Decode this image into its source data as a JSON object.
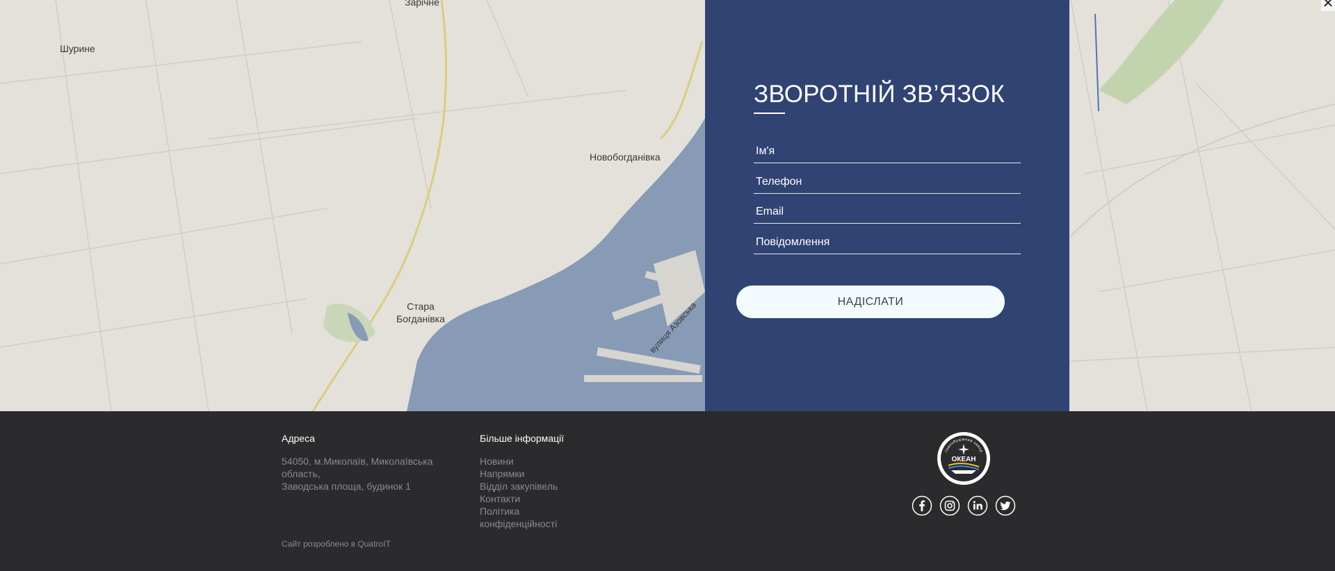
{
  "map": {
    "labels": {
      "zarichne": "Зарічне",
      "shuryne": "Шурине",
      "novobohdanivka": "Новобогданівка",
      "stara_line1": "Стара",
      "stara_line2": "Богданівка",
      "street": "вулиця Азовська"
    },
    "close_glyph": "✕"
  },
  "feedback": {
    "title": "ЗВОРОТНІЙ ЗВ’ЯЗОК",
    "name_placeholder": "Ім'я",
    "phone_placeholder": "Телефон",
    "email_placeholder": "Email",
    "message_placeholder": "Повідомлення",
    "submit_label": "НАДІСЛАТИ"
  },
  "footer": {
    "address_heading": "Адреса",
    "address_line1": "54050, м.Миколаїв, Миколаївська область,",
    "address_line2": "Заводська площа, будинок 1",
    "more_heading": "Більше інформації",
    "links": [
      "Новини",
      "Напрямки",
      "Відділ закупівель",
      "Контакти",
      "Політика конфіденційності"
    ],
    "credit": "Сайт розроблено в QuatroIT",
    "logo_text": "ОКЕАН",
    "logo_ring_text": "суднобудівний завод",
    "socials": [
      "facebook-icon",
      "instagram-icon",
      "linkedin-icon",
      "twitter-icon"
    ]
  },
  "colors": {
    "panel": "#182c64",
    "footer": "#2b2a2c",
    "button": "#f3fbff",
    "water": "#8fa3c1"
  }
}
